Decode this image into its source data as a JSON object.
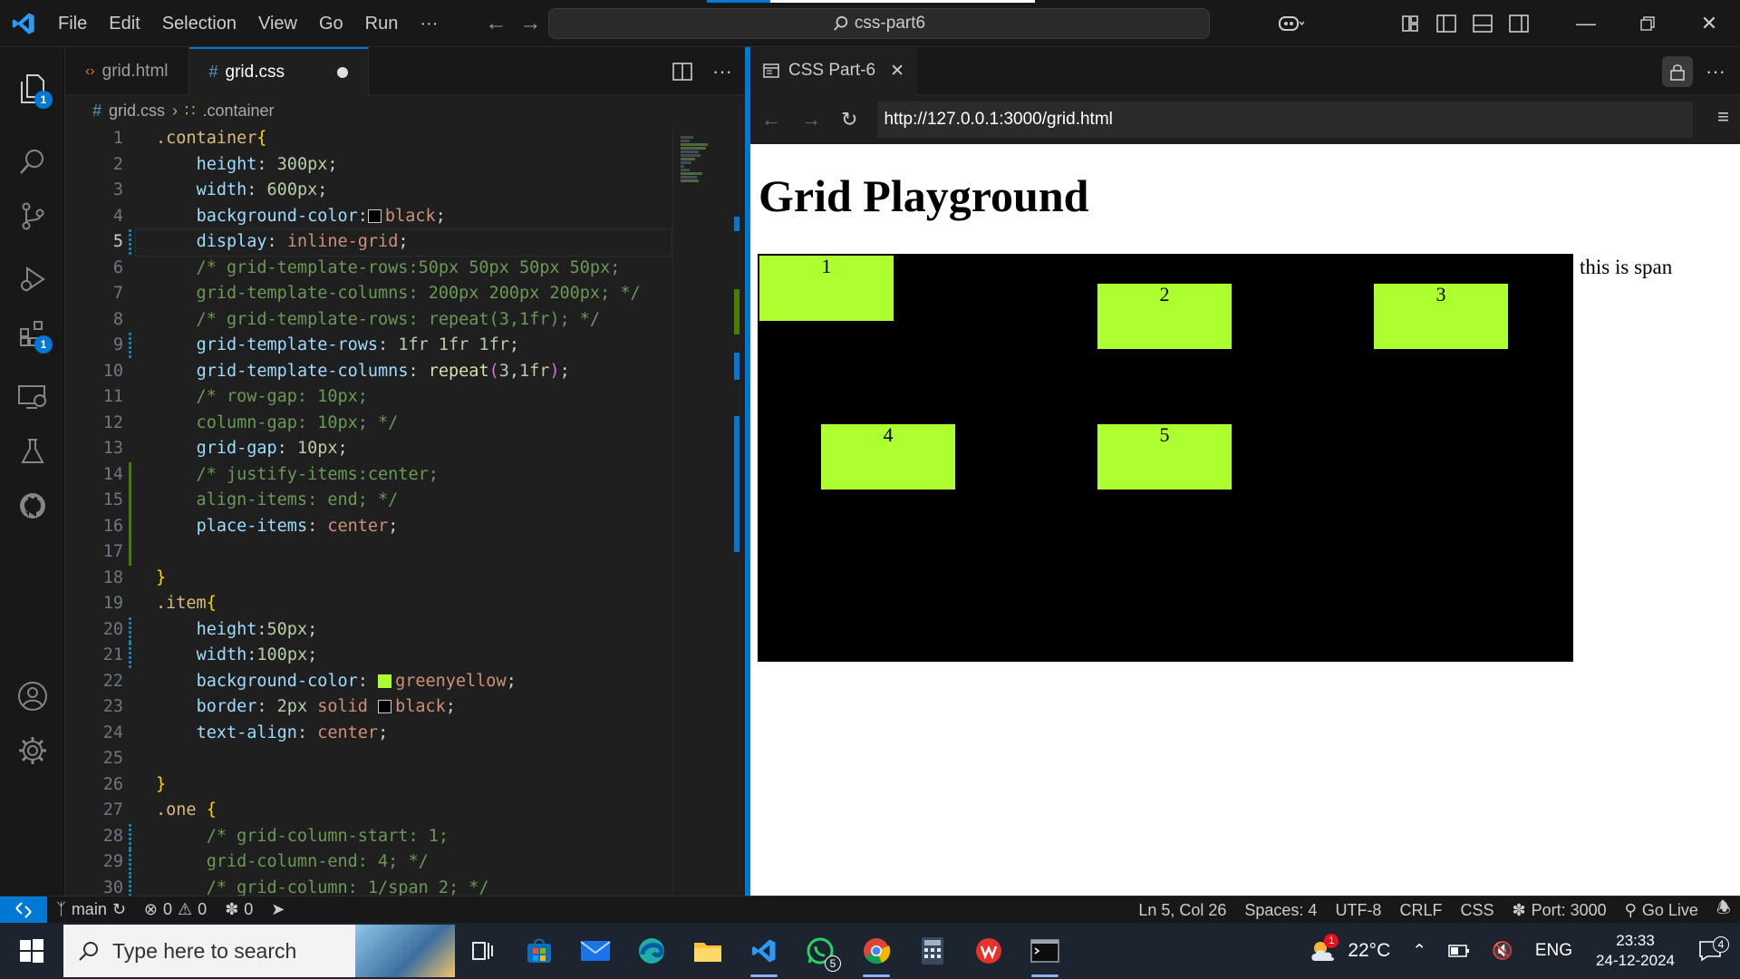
{
  "titlebar": {
    "menu": [
      "File",
      "Edit",
      "Selection",
      "View",
      "Go",
      "Run",
      "···"
    ],
    "search_text": "css-part6"
  },
  "activity_badges": {
    "explorer": "1",
    "extensions": "1"
  },
  "editor": {
    "tabs": [
      {
        "label": "grid.html",
        "icon": "html-icon"
      },
      {
        "label": "grid.css",
        "icon": "css-hash-icon",
        "modified": true
      }
    ],
    "breadcrumb": {
      "file": "grid.css",
      "symbol": ".container"
    },
    "current_line": 5,
    "code_lines": [
      ".container{",
      "    height: 300px;",
      "    width: 600px;",
      "    background-color: black;",
      "    display: inline-grid;",
      "    /* grid-template-rows:50px 50px 50px 50px;",
      "    grid-template-columns: 200px 200px 200px; */",
      "    /* grid-template-rows: repeat(3,1fr); */",
      "    grid-template-rows: 1fr 1fr 1fr;",
      "    grid-template-columns: repeat(3,1fr);",
      "    /* row-gap: 10px;",
      "    column-gap: 10px; */",
      "    grid-gap: 10px;",
      "    /* justify-items:center;",
      "    align-items: end; */",
      "    place-items: center;",
      "",
      "}",
      ".item{",
      "    height:50px;",
      "    width:100px;",
      "    background-color: greenyellow;",
      "    border: 2px solid black;",
      "    text-align: center;",
      "",
      "}",
      ".one {",
      "     /* grid-column-start: 1;",
      "     grid-column-end: 4; */",
      "     /* grid-column: 1/span 2; */"
    ]
  },
  "browser": {
    "tab_title": "CSS Part-6",
    "url": "http://127.0.0.1:3000/grid.html",
    "page": {
      "heading": "Grid Playground",
      "items": [
        "1",
        "2",
        "3",
        "4",
        "5"
      ],
      "span_text": "this is span",
      "container_color": "#000000",
      "item_color": "#adff2f"
    }
  },
  "statusbar": {
    "branch": "main",
    "errors": "0",
    "warnings": "0",
    "ports_forwarded": "0",
    "position": "Ln 5, Col 26",
    "spaces": "Spaces: 4",
    "encoding": "UTF-8",
    "eol": "CRLF",
    "language": "CSS",
    "port": "Port: 3000",
    "go_live": "Go Live"
  },
  "taskbar": {
    "search_placeholder": "Type here to search",
    "whatsapp_badge": "5",
    "weather_badge": "1",
    "temperature": "22°C",
    "language": "ENG",
    "time": "23:33",
    "date": "24-12-2024",
    "notification_count": "4"
  },
  "colors": {
    "accent": "#0078d4",
    "editor_bg": "#1f1f1f",
    "sidebar_bg": "#181818",
    "greenyellow": "#adff2f"
  }
}
